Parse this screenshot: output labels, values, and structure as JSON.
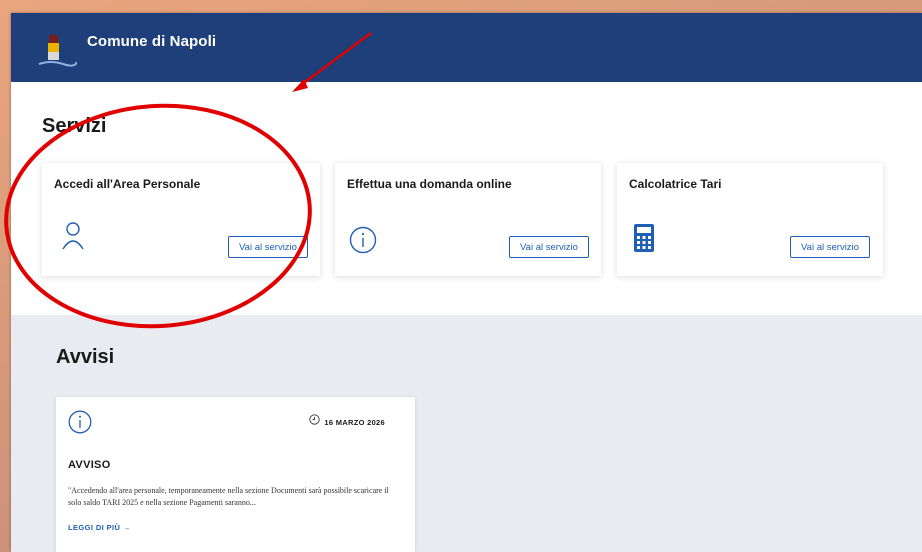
{
  "header": {
    "site_name": "Comune di Napoli"
  },
  "services": {
    "title": "Servizi",
    "cards": [
      {
        "title": "Accedi all'Area Personale",
        "icon": "user-icon",
        "button": "Vai al servizio"
      },
      {
        "title": "Effettua una domanda online",
        "icon": "info-icon",
        "button": "Vai al servizio"
      },
      {
        "title": "Calcolatrice Tari",
        "icon": "calculator-icon",
        "button": "Vai al servizio"
      }
    ]
  },
  "notices": {
    "title": "Avvisi",
    "items": [
      {
        "icon": "info-icon",
        "date": "16 MARZO 2026",
        "title": "AVVISO",
        "body": "\"Accedendo all'area personale, temporaneamente nella sezione Documenti sarà possibile scaricare il solo saldo TARI 2025 e nella sezione Pagamenti saranno...",
        "read_more": "LEGGI DI PIÙ →"
      }
    ]
  },
  "colors": {
    "header_bg": "#1f3f7a",
    "link": "#1f5fb4",
    "annotation": "#e00000"
  }
}
